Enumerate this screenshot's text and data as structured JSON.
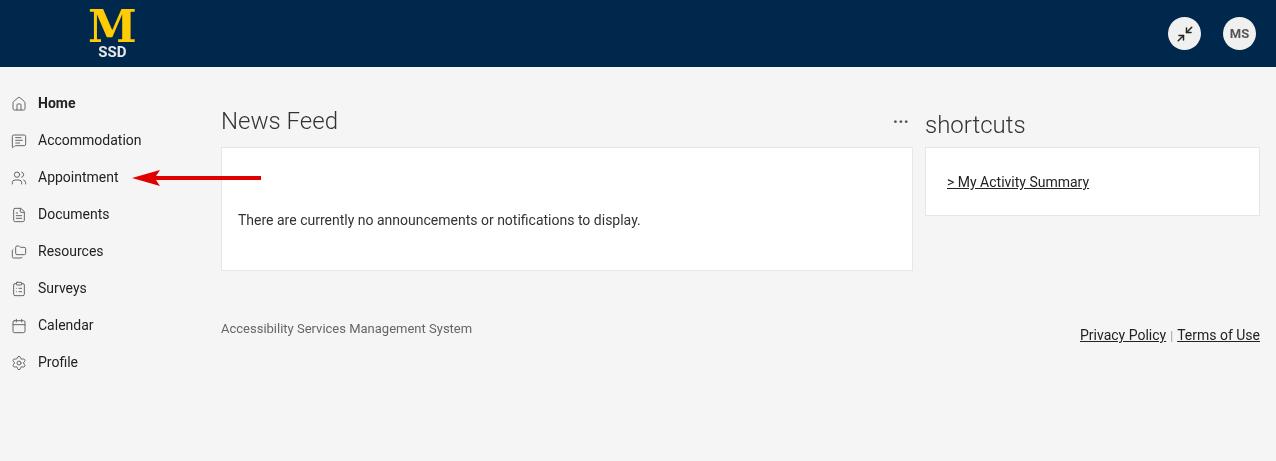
{
  "header": {
    "logo_letter": "M",
    "logo_text": "SSD",
    "avatar": "MS"
  },
  "sidebar": {
    "items": [
      {
        "label": "Home",
        "kind": "home",
        "selected": true
      },
      {
        "label": "Accommodation",
        "kind": "list",
        "selected": false
      },
      {
        "label": "Appointment",
        "kind": "people",
        "selected": false
      },
      {
        "label": "Documents",
        "kind": "doc",
        "selected": false
      },
      {
        "label": "Resources",
        "kind": "folder",
        "selected": false
      },
      {
        "label": "Surveys",
        "kind": "clipboard",
        "selected": false
      },
      {
        "label": "Calendar",
        "kind": "calendar",
        "selected": false
      },
      {
        "label": "Profile",
        "kind": "gear",
        "selected": false
      }
    ]
  },
  "news_feed": {
    "title": "News Feed",
    "more": "···",
    "message": "There are currently no announcements or notifications to display."
  },
  "shortcuts": {
    "title": "shortcuts",
    "links": [
      "> My Activity Summary"
    ]
  },
  "footer": {
    "system_name": "Accessibility Services Management System",
    "links": [
      "Privacy Policy",
      "Terms of Use"
    ],
    "separator": "|"
  }
}
